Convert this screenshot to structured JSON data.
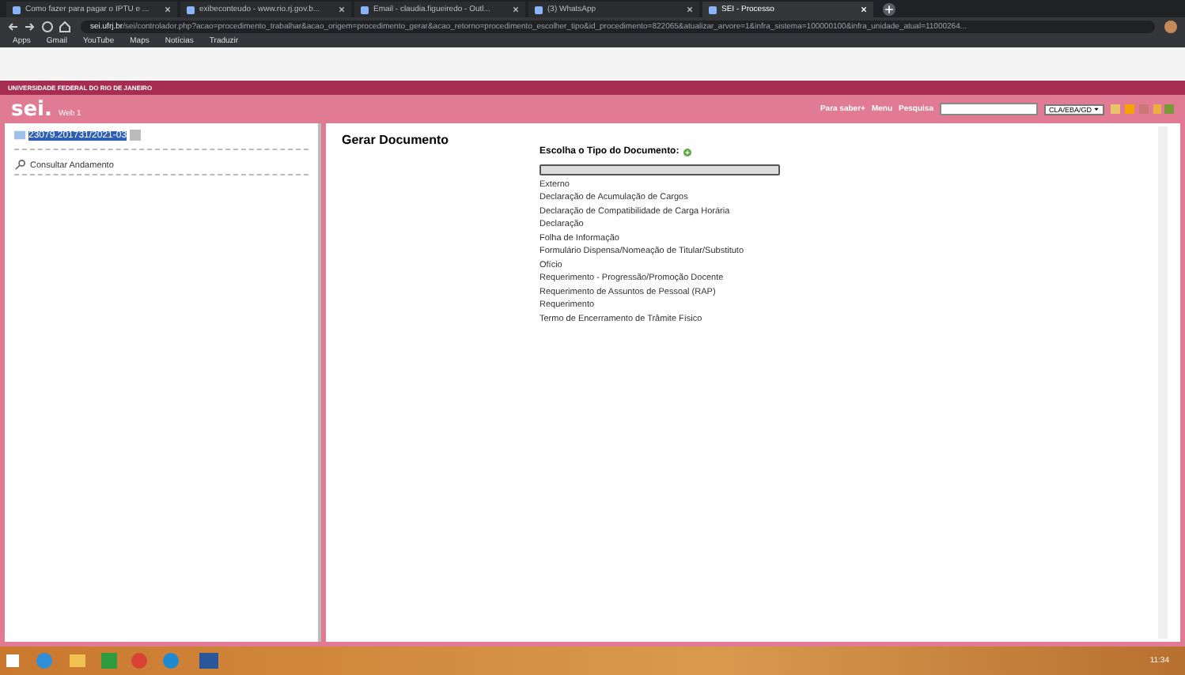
{
  "browser": {
    "tabs": [
      {
        "title": "Como fazer para pagar o IPTU e ...",
        "selected": false
      },
      {
        "title": "exibeconteudo - www.rio.rj.gov.b...",
        "selected": false
      },
      {
        "title": "Email - claudia.figueiredo - Outl...",
        "selected": false
      },
      {
        "title": "(3) WhatsApp",
        "selected": false
      },
      {
        "title": "SEI - Processo",
        "selected": true
      }
    ],
    "url_host": "sei.ufrj.br",
    "url_path": "/sei/controlador.php?acao=procedimento_trabalhar&acao_origem=procedimento_gerar&acao_retorno=procedimento_escolher_tipo&id_procedimento=822065&atualizar_arvore=1&infra_sistema=100000100&infra_unidade_atual=11000264...",
    "bookmarks": [
      "Apps",
      "Gmail",
      "YouTube",
      "Maps",
      "Notícias",
      "Traduzir"
    ]
  },
  "header": {
    "institution": "UNIVERSIDADE FEDERAL DO RIO DE JANEIRO",
    "logo": "sei.",
    "version": "Web 1",
    "links": [
      "Para saber+",
      "Menu",
      "Pesquisa"
    ],
    "unit": "CLA/EBA/GD"
  },
  "tree": {
    "process": "23079.201731/2021-03",
    "items": [
      "Consultar Andamento"
    ]
  },
  "main": {
    "title": "Gerar Documento",
    "prompt": "Escolha o Tipo do Documento:",
    "types": [
      "Externo",
      "Declaração de Acumulação de Cargos",
      "Declaração de Compatibilidade de Carga Horária",
      "Declaração",
      "Folha de Informação",
      "Formulário Dispensa/Nomeação de Titular/Substituto",
      "Ofício",
      "Requerimento - Progressão/Promoção Docente",
      "Requerimento de Assuntos de Pessoal (RAP)",
      "Requerimento",
      "Termo de Encerramento de Trâmite Físico"
    ]
  },
  "taskbar": {
    "time": "11:34"
  }
}
